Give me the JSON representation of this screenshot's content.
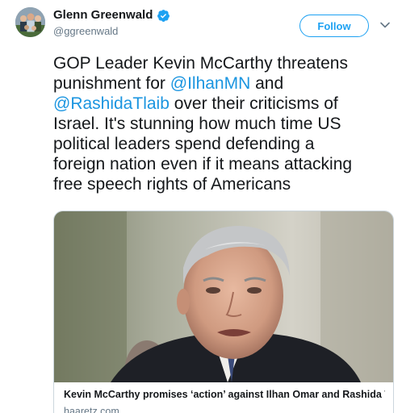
{
  "author": {
    "display_name": "Glenn Greenwald",
    "handle": "@ggreenwald",
    "verified": true,
    "avatar_icon": "avatar-group-photo"
  },
  "actions": {
    "follow_label": "Follow",
    "menu_icon": "chevron-down-icon"
  },
  "tweet": {
    "line1": "GOP Leader Kevin McCarthy threatens",
    "line2_prefix": "punishment for ",
    "mention1": "@IlhanMN",
    "line2_suffix": " and",
    "mention2": "@RashidaTlaib",
    "line3_suffix": " over their criticisms of",
    "line4": "Israel. It's stunning how much time US",
    "line5": "political leaders spend defending a",
    "line6": "foreign nation even if it means attacking",
    "line7": "free speech rights of Americans"
  },
  "card": {
    "title": "Kevin McCarthy promises ‘action’ against Ilhan Omar and Rashida T...",
    "domain": "haaretz.com",
    "image_icon": "news-photo"
  },
  "colors": {
    "accent": "#1da1f2",
    "mention": "#1b95e0",
    "text": "#14171a",
    "secondary": "#657786",
    "border": "#ccd6dd"
  }
}
